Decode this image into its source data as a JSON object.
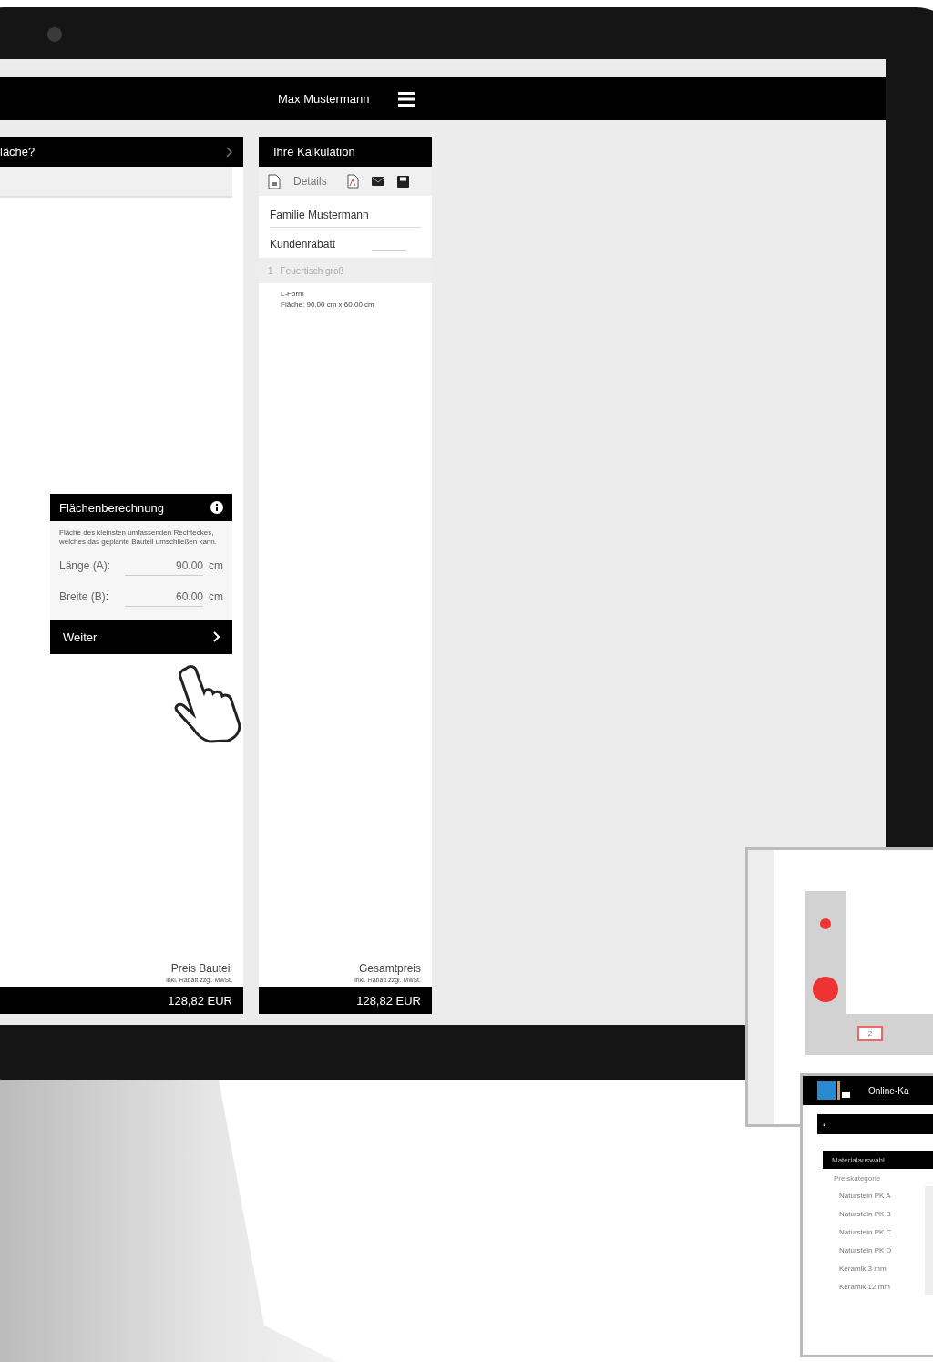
{
  "header": {
    "user_name": "Max Mustermann"
  },
  "left_panel": {
    "title": "läche?",
    "card": {
      "title": "Flächenberechnung",
      "description": "Fläche des kleinsten umfassenden Rechteckes, welches das geplante Bauteil umschließen kann.",
      "fields": [
        {
          "label": "Länge (A):",
          "value": "90.00",
          "unit": "cm"
        },
        {
          "label": "Breite (B):",
          "value": "60.00",
          "unit": "cm"
        }
      ],
      "button": "Weiter"
    },
    "price_label": "Preis Bauteil",
    "price_note": "inkl. Rabatt zzgl. MwSt.",
    "price": "128,82 EUR"
  },
  "right_panel": {
    "title": "Ihre Kalkulation",
    "toolbar": {
      "details": "Details"
    },
    "customer": "Familie Mustermann",
    "discount_label": "Kundenrabatt",
    "item": {
      "number": "1",
      "name": "Feuertisch groß",
      "disabled": true,
      "lines": [
        "L-Form",
        "Fläche: 90.00 cm x 60.00 cm"
      ]
    },
    "total_label": "Gesamtpreis",
    "total_note": "inkl. Rabatt zzgl. MwSt.",
    "total": "128,82 EUR"
  },
  "overlay_drawing": {
    "dimension": "2"
  },
  "overlay_app": {
    "title": "Online-Ka",
    "back": "‹",
    "section": "Materialauswahl",
    "column": "Preiskategorie",
    "rows": [
      "Naturstein PK A",
      "Naturstein PK B",
      "Naturstein PK C",
      "Naturstein PK D",
      "Keramik 3 mm",
      "Keramik 12 mm"
    ]
  }
}
